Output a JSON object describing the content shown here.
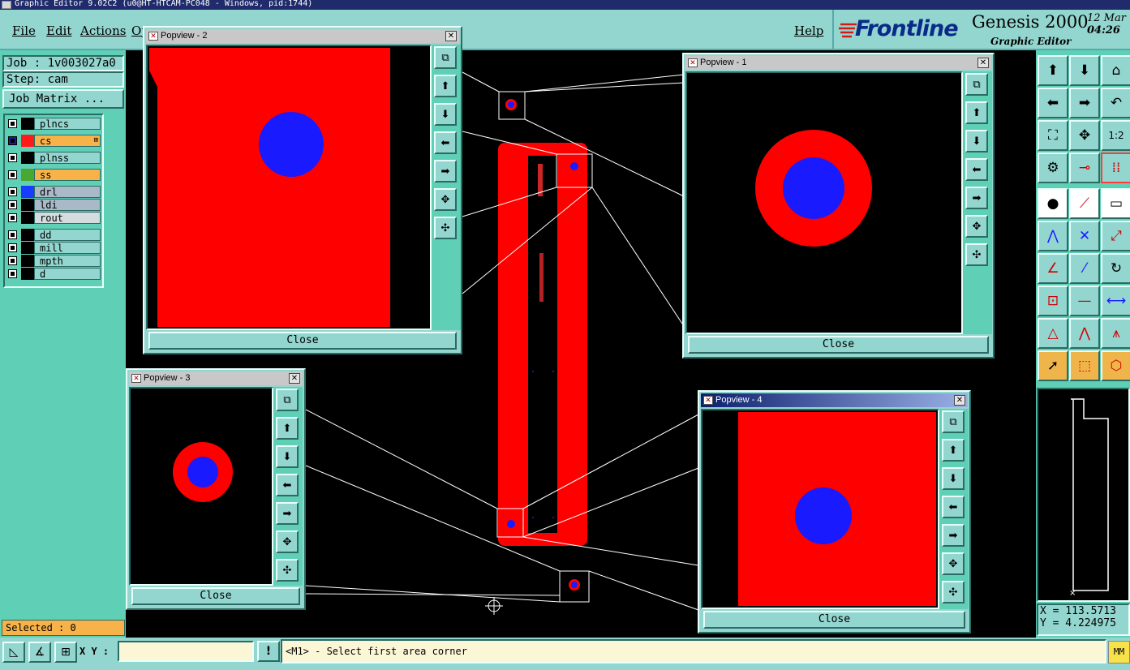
{
  "window_title": "Graphic Editor 9.02C2 (u0@HT-HTCAM-PC048 - Windows, pid:1744)",
  "menu": {
    "file": "File",
    "edit": "Edit",
    "actions": "Actions",
    "options": "Op",
    "help": "Help"
  },
  "brand": {
    "logo": "Frontline",
    "product": "Genesis 2000",
    "subtitle": "Graphic Editor",
    "date": "12 Mar",
    "time": "04:26"
  },
  "job": {
    "job_label": "Job : 1v003027a0",
    "step_label": "Step: cam",
    "matrix_button": "Job Matrix ..."
  },
  "layers": [
    {
      "name": "plncs",
      "color": "#000000",
      "bg": "#93d6cf"
    },
    {
      "name": "cs",
      "color": "#ff1a1a",
      "bg": "#f7b34a",
      "active": true
    },
    {
      "name": "plnss",
      "color": "#000000",
      "bg": "#93d6cf"
    },
    {
      "name": "ss",
      "color": "#4aa832",
      "bg": "#f7b34a"
    },
    {
      "name": "drl",
      "color": "#1a3cff",
      "bg": "#a9b9c7"
    },
    {
      "name": "ldi",
      "color": "#000000",
      "bg": "#a9b9c7"
    },
    {
      "name": "rout",
      "color": "#000000",
      "bg": "#d4dce0"
    },
    {
      "name": "dd",
      "color": "#000000",
      "bg": "#93d6cf"
    },
    {
      "name": "mill",
      "color": "#000000",
      "bg": "#93d6cf"
    },
    {
      "name": "mpth",
      "color": "#000000",
      "bg": "#93d6cf"
    },
    {
      "name": "d",
      "color": "#000000",
      "bg": "#93d6cf"
    }
  ],
  "selected": "Selected : 0",
  "popups": {
    "p1": {
      "title": "Popview - 1",
      "close": "Close"
    },
    "p2": {
      "title": "Popview - 2",
      "close": "Close"
    },
    "p3": {
      "title": "Popview - 3",
      "close": "Close"
    },
    "p4": {
      "title": "Popview - 4",
      "close": "Close"
    }
  },
  "coords": {
    "x": "X = 113.5713",
    "y": "Y = 4.224975"
  },
  "statusbar": {
    "xy_label": "X Y :",
    "xy_value": "",
    "message": "<M1> - Select first area corner",
    "units": "MM"
  },
  "tools": {
    "ratio": "1:2"
  },
  "colors": {
    "copper": "#ff0000",
    "drill": "#1a1aff",
    "panel_bg": "#93d6cf",
    "panel_dark": "#5fcfb6",
    "selected_bg": "#f7b34a"
  }
}
